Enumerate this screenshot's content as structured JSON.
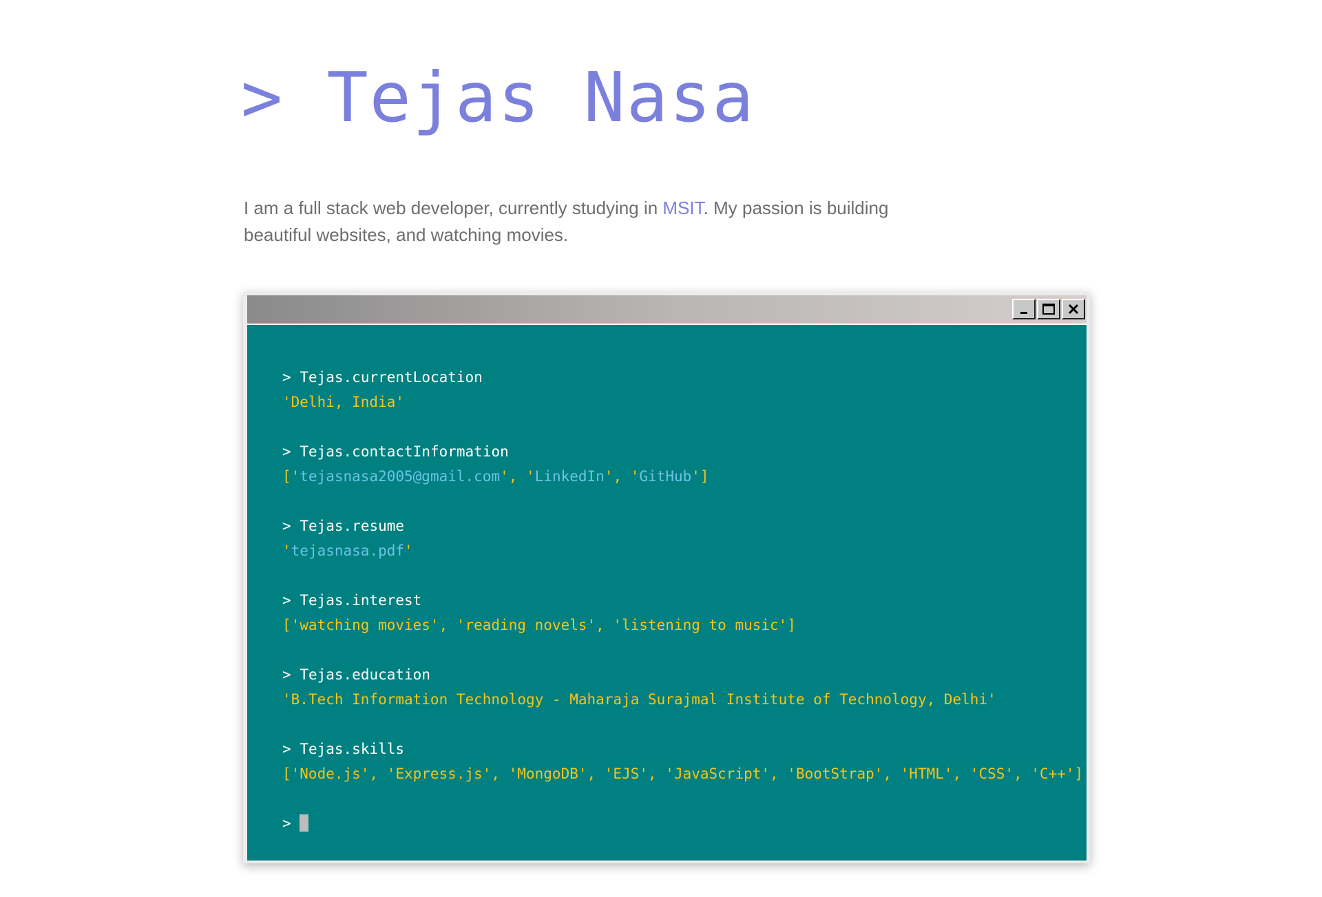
{
  "header": {
    "prompt": ">",
    "name": "Tejas Nasa"
  },
  "intro": {
    "text_before": "I am a full stack web developer, currently studying in ",
    "link": "MSIT",
    "text_after": ". My passion is building beautiful websites, and watching movies."
  },
  "window": {
    "controls": [
      "minimize-icon",
      "maximize-icon",
      "close-icon"
    ]
  },
  "terminal": {
    "prompt_symbol": ">",
    "location": {
      "command": "Tejas.currentLocation",
      "value": "'Delhi, India'"
    },
    "contact": {
      "command": "Tejas.contactInformation",
      "open": "['",
      "email": "tejasnasa2005@gmail.com",
      "sep1": "', '",
      "linkedin": "LinkedIn",
      "sep2": "', '",
      "github": "GitHub",
      "close": "']"
    },
    "resume": {
      "command": "Tejas.resume",
      "open": "'",
      "file": "tejasnasa.pdf",
      "close": "'"
    },
    "interest": {
      "command": "Tejas.interest",
      "value": "['watching movies', 'reading novels', 'listening to music']"
    },
    "education": {
      "command": "Tejas.education",
      "value": "'B.Tech Information Technology - Maharaja Surajmal Institute of Technology, Delhi'"
    },
    "skills": {
      "command": "Tejas.skills",
      "value": "['Node.js', 'Express.js', 'MongoDB', 'EJS', 'JavaScript', 'BootStrap', 'HTML', 'CSS', 'C++']"
    }
  },
  "colors": {
    "accent": "#7b80dc",
    "terminal_bg": "#008080",
    "output": "#f5c518",
    "link": "#6cc2e6",
    "text": "#6e6e6e"
  }
}
